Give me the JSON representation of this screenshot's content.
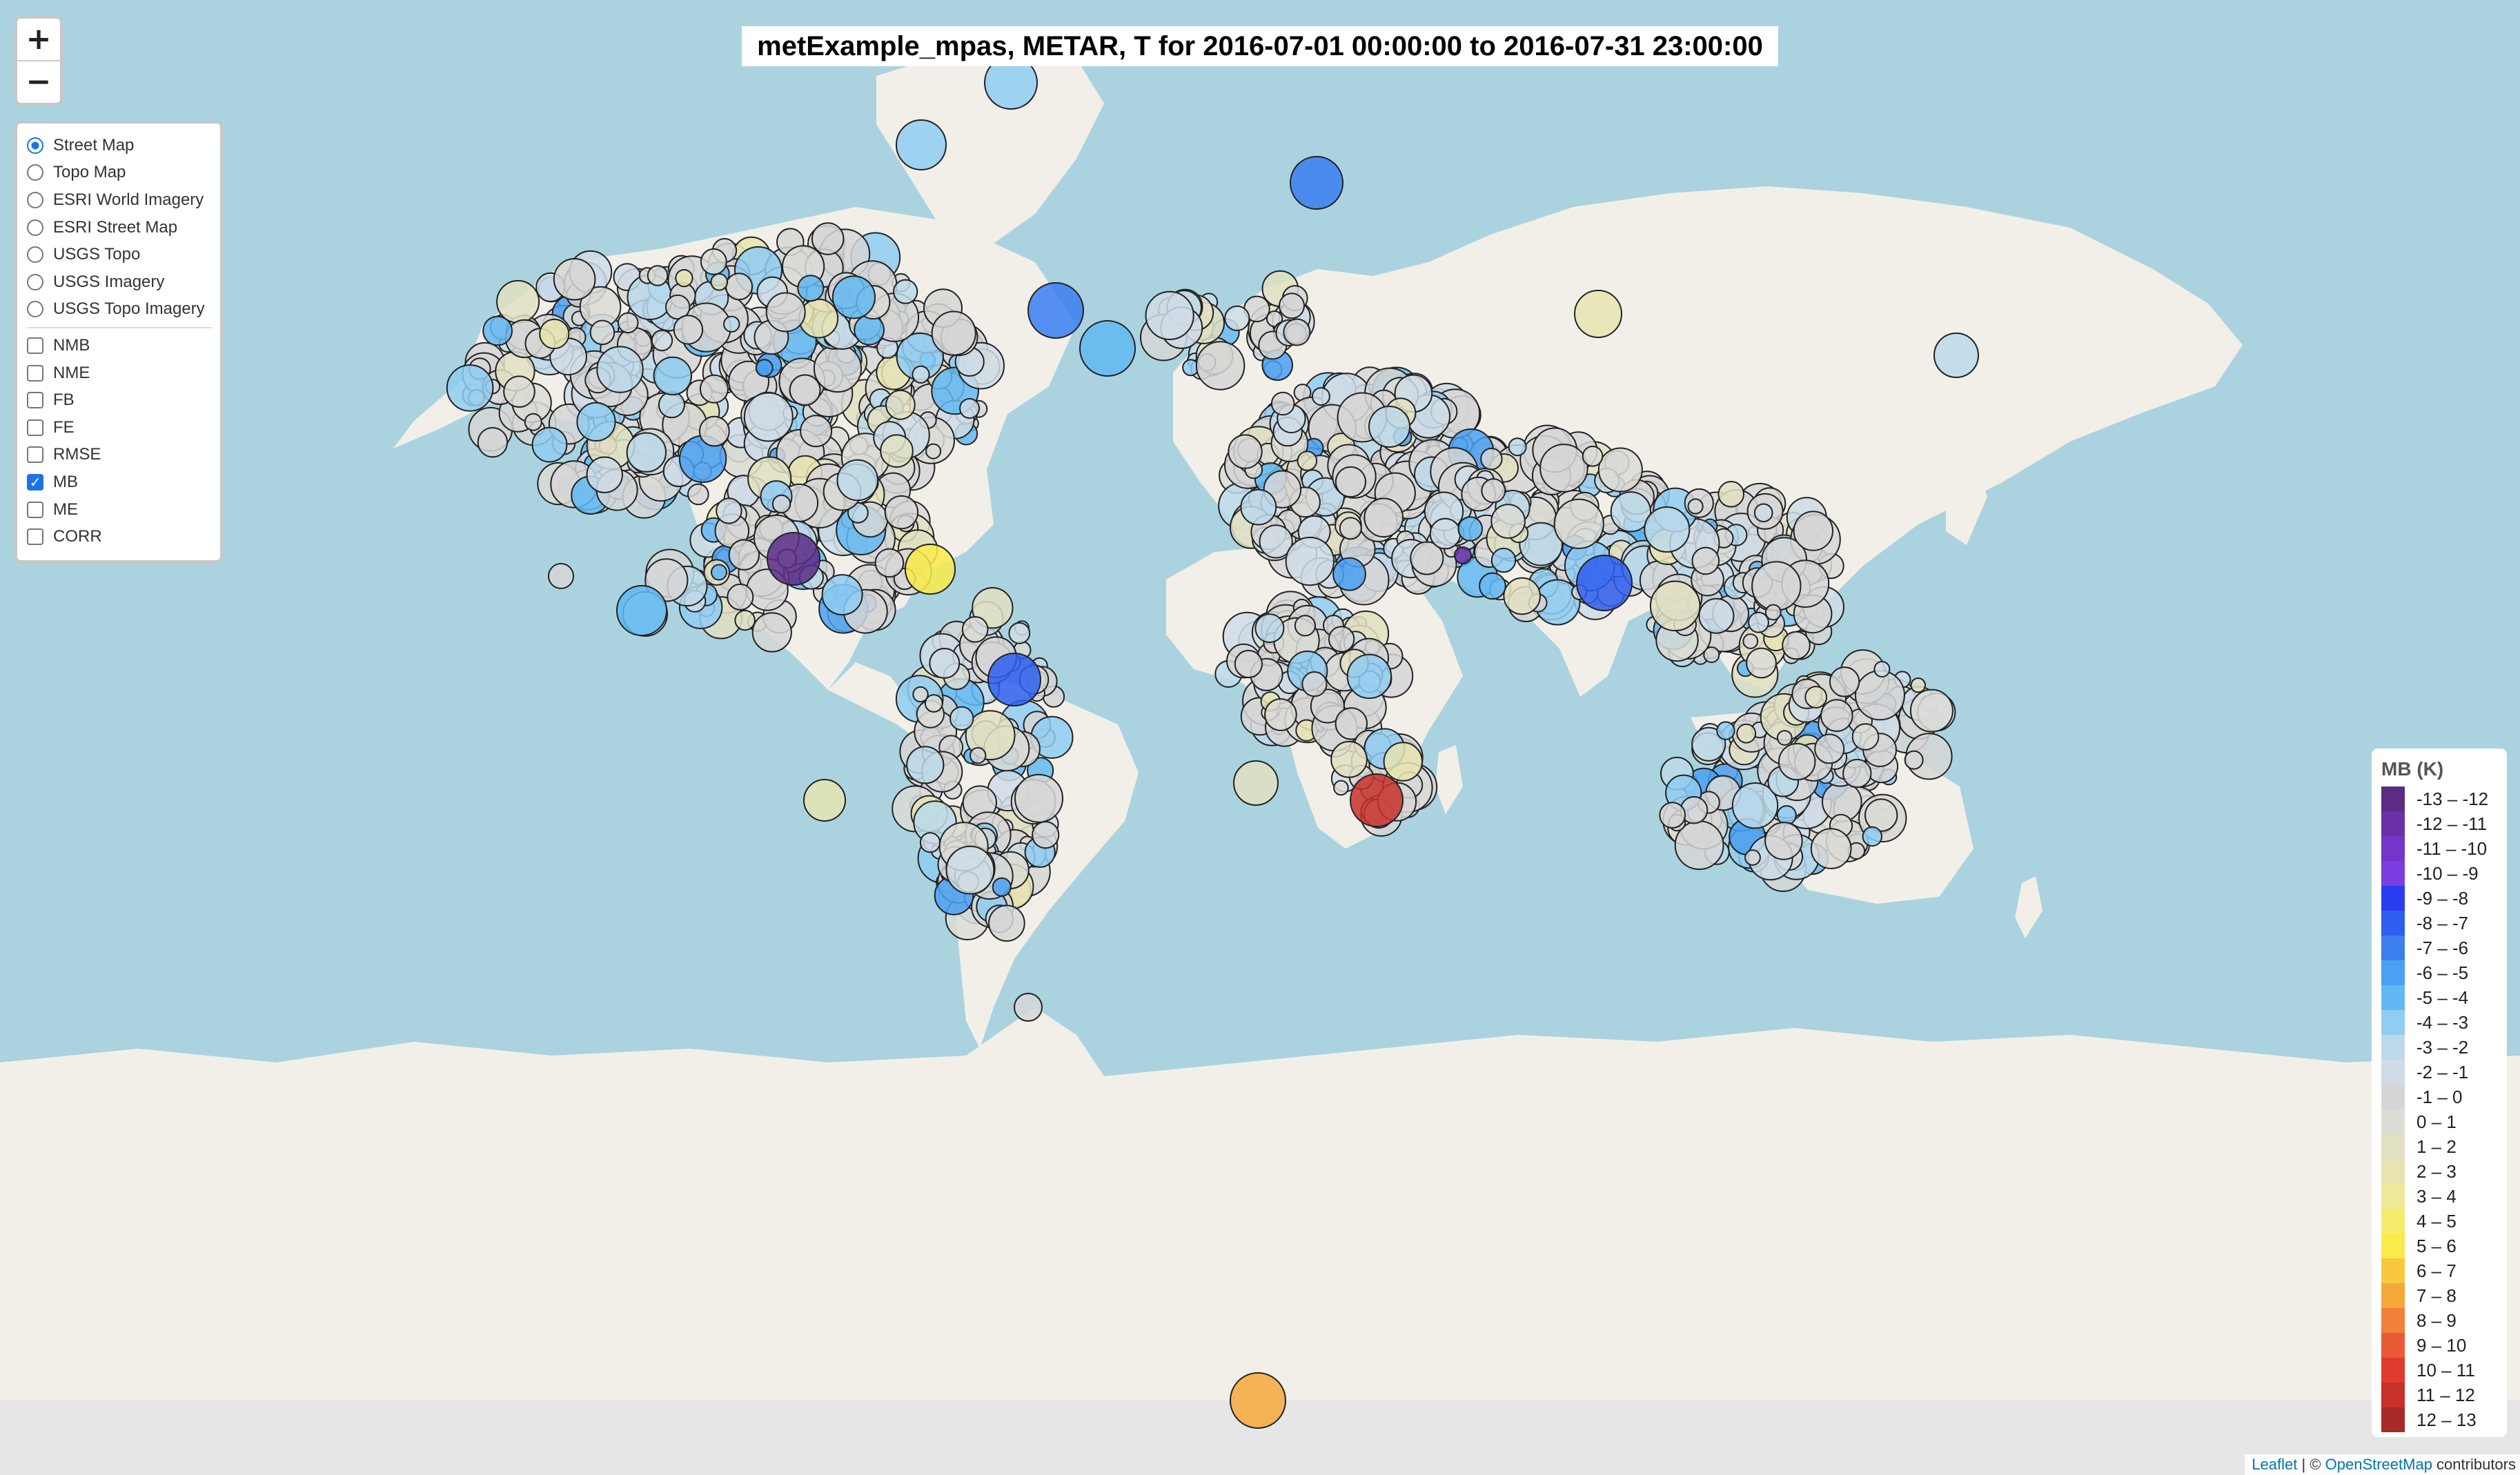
{
  "title": "metExample_mpas, METAR, T for 2016-07-01 00:00:00 to 2016-07-31 23:00:00",
  "zoom": {
    "in_label": "+",
    "out_label": "−"
  },
  "base_layers": [
    {
      "label": "Street Map",
      "checked": true
    },
    {
      "label": "Topo Map",
      "checked": false
    },
    {
      "label": "ESRI World Imagery",
      "checked": false
    },
    {
      "label": "ESRI Street Map",
      "checked": false
    },
    {
      "label": "USGS Topo",
      "checked": false
    },
    {
      "label": "USGS Imagery",
      "checked": false
    },
    {
      "label": "USGS Topo Imagery",
      "checked": false
    }
  ],
  "overlays": [
    {
      "label": "NMB",
      "checked": false
    },
    {
      "label": "NME",
      "checked": false
    },
    {
      "label": "FB",
      "checked": false
    },
    {
      "label": "FE",
      "checked": false
    },
    {
      "label": "RMSE",
      "checked": false
    },
    {
      "label": "MB",
      "checked": true
    },
    {
      "label": "ME",
      "checked": false
    },
    {
      "label": "CORR",
      "checked": false
    }
  ],
  "legend": {
    "title": "MB (K)",
    "items": [
      {
        "label": "-13 – -12",
        "color": "#5b2c86"
      },
      {
        "label": "-12 – -11",
        "color": "#6a30a8"
      },
      {
        "label": "-11 – -10",
        "color": "#7436c8"
      },
      {
        "label": "-10 – -9",
        "color": "#7a3ee0"
      },
      {
        "label": "-9 – -8",
        "color": "#2b3cf0"
      },
      {
        "label": "-8 – -7",
        "color": "#2e5ef0"
      },
      {
        "label": "-7 – -6",
        "color": "#3a7ef0"
      },
      {
        "label": "-6 – -5",
        "color": "#4aa0f2"
      },
      {
        "label": "-5 – -4",
        "color": "#62b8f2"
      },
      {
        "label": "-4 – -3",
        "color": "#8fcdf2"
      },
      {
        "label": "-3 – -2",
        "color": "#bcd9ea"
      },
      {
        "label": "-2 – -1",
        "color": "#cfdce6"
      },
      {
        "label": "-1 – 0",
        "color": "#d6d6d6"
      },
      {
        "label": "0 – 1",
        "color": "#dcdcd6"
      },
      {
        "label": "1 – 2",
        "color": "#e2e0c2"
      },
      {
        "label": "2 – 3",
        "color": "#e8e4b0"
      },
      {
        "label": "3 – 4",
        "color": "#efe898"
      },
      {
        "label": "4 – 5",
        "color": "#f6ec6c"
      },
      {
        "label": "5 – 6",
        "color": "#faeb4a"
      },
      {
        "label": "6 – 7",
        "color": "#f8c93e"
      },
      {
        "label": "7 – 8",
        "color": "#f4a83a"
      },
      {
        "label": "8 – 9",
        "color": "#f0803a"
      },
      {
        "label": "9 – 10",
        "color": "#ea5a34"
      },
      {
        "label": "10 – 11",
        "color": "#e03a2e"
      },
      {
        "label": "11 – 12",
        "color": "#c8302a"
      },
      {
        "label": "12 – 13",
        "color": "#a82a26"
      }
    ]
  },
  "attribution": {
    "leaflet": "Leaflet",
    "separator": " | © ",
    "osm": "OpenStreetMap",
    "suffix": " contributors"
  },
  "colors": {
    "ocean": "#aad3df",
    "land": "#f2efe9",
    "marker_stroke": "#222222"
  },
  "icons": {
    "zoom_in": "plus-icon",
    "zoom_out": "minus-icon",
    "checked_overlay": "checkmark-icon"
  }
}
